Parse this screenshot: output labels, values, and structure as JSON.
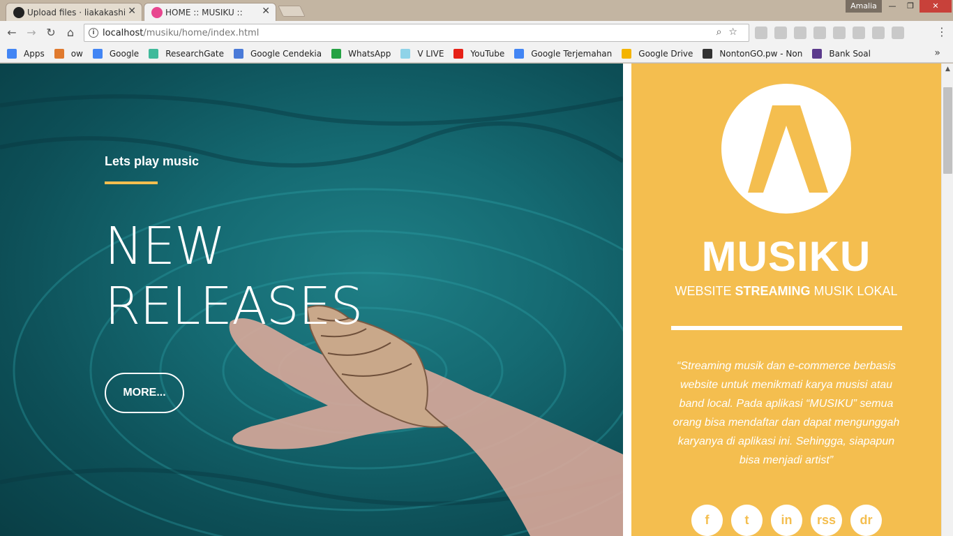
{
  "browser": {
    "tabs": [
      {
        "title": "Upload files · liakakashi/A"
      },
      {
        "title": "HOME :: MUSIKU ::"
      }
    ],
    "profile_name": "Amalia",
    "address": {
      "host": "localhost",
      "path": "/musiku/home/index.html"
    },
    "bookmarks": [
      {
        "label": "Apps",
        "icon": "apps-grid-icon",
        "color": "#4285f4"
      },
      {
        "label": "ow",
        "icon": "e-icon",
        "color": "#e07a2e"
      },
      {
        "label": "Google",
        "icon": "google-icon",
        "color": "#4285f4"
      },
      {
        "label": "ResearchGate",
        "icon": "researchgate-icon",
        "color": "#40ba9b"
      },
      {
        "label": "Google Cendekia",
        "icon": "scholar-icon",
        "color": "#4a7ad8"
      },
      {
        "label": "WhatsApp",
        "icon": "whatsapp-icon",
        "color": "#25a244"
      },
      {
        "label": "V LIVE",
        "icon": "vlive-icon",
        "color": "#8fd3e8"
      },
      {
        "label": "YouTube",
        "icon": "youtube-icon",
        "color": "#e62117"
      },
      {
        "label": "Google Terjemahan",
        "icon": "translate-icon",
        "color": "#4285f4"
      },
      {
        "label": "Google Drive",
        "icon": "drive-icon",
        "color": "#f4b400"
      },
      {
        "label": "NontonGO.pw - Non",
        "icon": "film-icon",
        "color": "#333333"
      },
      {
        "label": "Bank Soal",
        "icon": "b-icon",
        "color": "#5b3a8c"
      }
    ]
  },
  "hero": {
    "tagline": "Lets play music",
    "title_line1": "NEW",
    "title_line2": "RELEASES",
    "button": "MORE..."
  },
  "sidebar": {
    "brand": "MUSIKU",
    "tagline_prefix": "WEBSITE ",
    "tagline_bold": "STREAMING",
    "tagline_suffix": " MUSIK LOKAL",
    "quote": "“Streaming musik dan e-commerce berbasis website untuk menikmati karya musisi atau band local. Pada aplikasi “MUSIKU” semua orang bisa mendaftar dan dapat mengunggah karyanya di aplikasi ini. Sehingga, siapapun bisa menjadi artist”",
    "socials": [
      {
        "label": "f",
        "icon": "facebook-icon"
      },
      {
        "label": "t",
        "icon": "twitter-icon"
      },
      {
        "label": "in",
        "icon": "linkedin-icon"
      },
      {
        "label": "rss",
        "icon": "rss-icon"
      },
      {
        "label": "dr",
        "icon": "dribbble-icon"
      }
    ]
  },
  "colors": {
    "accent": "#f4be4f",
    "hero_water": "#156a72"
  }
}
